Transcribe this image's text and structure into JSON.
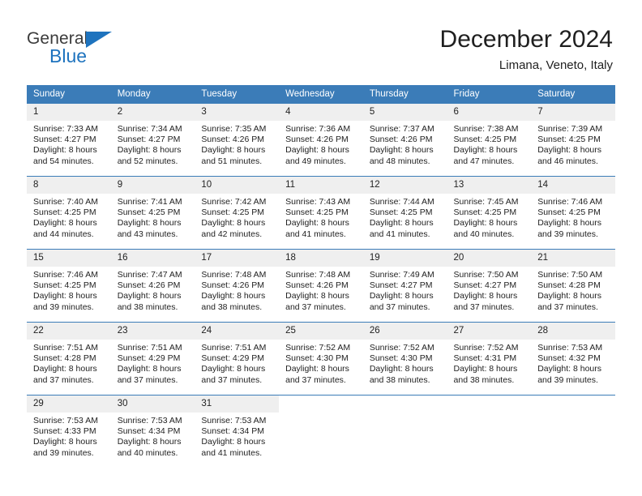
{
  "brand": {
    "name_top": "General",
    "name_bottom": "Blue",
    "accent_color": "#1e73be",
    "triangle_icon": "triangle-icon"
  },
  "header": {
    "title": "December 2024",
    "subtitle": "Limana, Veneto, Italy"
  },
  "theme": {
    "header_row_color": "#3b7cb8",
    "daynum_band_color": "#efefef",
    "text_color": "#222222",
    "page_background": "#ffffff"
  },
  "calendar": {
    "weekday_headers": [
      "Sunday",
      "Monday",
      "Tuesday",
      "Wednesday",
      "Thursday",
      "Friday",
      "Saturday"
    ],
    "weeks": [
      [
        {
          "day": "1",
          "sunrise": "Sunrise: 7:33 AM",
          "sunset": "Sunset: 4:27 PM",
          "daylight_line1": "Daylight: 8 hours",
          "daylight_line2": "and 54 minutes."
        },
        {
          "day": "2",
          "sunrise": "Sunrise: 7:34 AM",
          "sunset": "Sunset: 4:27 PM",
          "daylight_line1": "Daylight: 8 hours",
          "daylight_line2": "and 52 minutes."
        },
        {
          "day": "3",
          "sunrise": "Sunrise: 7:35 AM",
          "sunset": "Sunset: 4:26 PM",
          "daylight_line1": "Daylight: 8 hours",
          "daylight_line2": "and 51 minutes."
        },
        {
          "day": "4",
          "sunrise": "Sunrise: 7:36 AM",
          "sunset": "Sunset: 4:26 PM",
          "daylight_line1": "Daylight: 8 hours",
          "daylight_line2": "and 49 minutes."
        },
        {
          "day": "5",
          "sunrise": "Sunrise: 7:37 AM",
          "sunset": "Sunset: 4:26 PM",
          "daylight_line1": "Daylight: 8 hours",
          "daylight_line2": "and 48 minutes."
        },
        {
          "day": "6",
          "sunrise": "Sunrise: 7:38 AM",
          "sunset": "Sunset: 4:25 PM",
          "daylight_line1": "Daylight: 8 hours",
          "daylight_line2": "and 47 minutes."
        },
        {
          "day": "7",
          "sunrise": "Sunrise: 7:39 AM",
          "sunset": "Sunset: 4:25 PM",
          "daylight_line1": "Daylight: 8 hours",
          "daylight_line2": "and 46 minutes."
        }
      ],
      [
        {
          "day": "8",
          "sunrise": "Sunrise: 7:40 AM",
          "sunset": "Sunset: 4:25 PM",
          "daylight_line1": "Daylight: 8 hours",
          "daylight_line2": "and 44 minutes."
        },
        {
          "day": "9",
          "sunrise": "Sunrise: 7:41 AM",
          "sunset": "Sunset: 4:25 PM",
          "daylight_line1": "Daylight: 8 hours",
          "daylight_line2": "and 43 minutes."
        },
        {
          "day": "10",
          "sunrise": "Sunrise: 7:42 AM",
          "sunset": "Sunset: 4:25 PM",
          "daylight_line1": "Daylight: 8 hours",
          "daylight_line2": "and 42 minutes."
        },
        {
          "day": "11",
          "sunrise": "Sunrise: 7:43 AM",
          "sunset": "Sunset: 4:25 PM",
          "daylight_line1": "Daylight: 8 hours",
          "daylight_line2": "and 41 minutes."
        },
        {
          "day": "12",
          "sunrise": "Sunrise: 7:44 AM",
          "sunset": "Sunset: 4:25 PM",
          "daylight_line1": "Daylight: 8 hours",
          "daylight_line2": "and 41 minutes."
        },
        {
          "day": "13",
          "sunrise": "Sunrise: 7:45 AM",
          "sunset": "Sunset: 4:25 PM",
          "daylight_line1": "Daylight: 8 hours",
          "daylight_line2": "and 40 minutes."
        },
        {
          "day": "14",
          "sunrise": "Sunrise: 7:46 AM",
          "sunset": "Sunset: 4:25 PM",
          "daylight_line1": "Daylight: 8 hours",
          "daylight_line2": "and 39 minutes."
        }
      ],
      [
        {
          "day": "15",
          "sunrise": "Sunrise: 7:46 AM",
          "sunset": "Sunset: 4:25 PM",
          "daylight_line1": "Daylight: 8 hours",
          "daylight_line2": "and 39 minutes."
        },
        {
          "day": "16",
          "sunrise": "Sunrise: 7:47 AM",
          "sunset": "Sunset: 4:26 PM",
          "daylight_line1": "Daylight: 8 hours",
          "daylight_line2": "and 38 minutes."
        },
        {
          "day": "17",
          "sunrise": "Sunrise: 7:48 AM",
          "sunset": "Sunset: 4:26 PM",
          "daylight_line1": "Daylight: 8 hours",
          "daylight_line2": "and 38 minutes."
        },
        {
          "day": "18",
          "sunrise": "Sunrise: 7:48 AM",
          "sunset": "Sunset: 4:26 PM",
          "daylight_line1": "Daylight: 8 hours",
          "daylight_line2": "and 37 minutes."
        },
        {
          "day": "19",
          "sunrise": "Sunrise: 7:49 AM",
          "sunset": "Sunset: 4:27 PM",
          "daylight_line1": "Daylight: 8 hours",
          "daylight_line2": "and 37 minutes."
        },
        {
          "day": "20",
          "sunrise": "Sunrise: 7:50 AM",
          "sunset": "Sunset: 4:27 PM",
          "daylight_line1": "Daylight: 8 hours",
          "daylight_line2": "and 37 minutes."
        },
        {
          "day": "21",
          "sunrise": "Sunrise: 7:50 AM",
          "sunset": "Sunset: 4:28 PM",
          "daylight_line1": "Daylight: 8 hours",
          "daylight_line2": "and 37 minutes."
        }
      ],
      [
        {
          "day": "22",
          "sunrise": "Sunrise: 7:51 AM",
          "sunset": "Sunset: 4:28 PM",
          "daylight_line1": "Daylight: 8 hours",
          "daylight_line2": "and 37 minutes."
        },
        {
          "day": "23",
          "sunrise": "Sunrise: 7:51 AM",
          "sunset": "Sunset: 4:29 PM",
          "daylight_line1": "Daylight: 8 hours",
          "daylight_line2": "and 37 minutes."
        },
        {
          "day": "24",
          "sunrise": "Sunrise: 7:51 AM",
          "sunset": "Sunset: 4:29 PM",
          "daylight_line1": "Daylight: 8 hours",
          "daylight_line2": "and 37 minutes."
        },
        {
          "day": "25",
          "sunrise": "Sunrise: 7:52 AM",
          "sunset": "Sunset: 4:30 PM",
          "daylight_line1": "Daylight: 8 hours",
          "daylight_line2": "and 37 minutes."
        },
        {
          "day": "26",
          "sunrise": "Sunrise: 7:52 AM",
          "sunset": "Sunset: 4:30 PM",
          "daylight_line1": "Daylight: 8 hours",
          "daylight_line2": "and 38 minutes."
        },
        {
          "day": "27",
          "sunrise": "Sunrise: 7:52 AM",
          "sunset": "Sunset: 4:31 PM",
          "daylight_line1": "Daylight: 8 hours",
          "daylight_line2": "and 38 minutes."
        },
        {
          "day": "28",
          "sunrise": "Sunrise: 7:53 AM",
          "sunset": "Sunset: 4:32 PM",
          "daylight_line1": "Daylight: 8 hours",
          "daylight_line2": "and 39 minutes."
        }
      ],
      [
        {
          "day": "29",
          "sunrise": "Sunrise: 7:53 AM",
          "sunset": "Sunset: 4:33 PM",
          "daylight_line1": "Daylight: 8 hours",
          "daylight_line2": "and 39 minutes."
        },
        {
          "day": "30",
          "sunrise": "Sunrise: 7:53 AM",
          "sunset": "Sunset: 4:34 PM",
          "daylight_line1": "Daylight: 8 hours",
          "daylight_line2": "and 40 minutes."
        },
        {
          "day": "31",
          "sunrise": "Sunrise: 7:53 AM",
          "sunset": "Sunset: 4:34 PM",
          "daylight_line1": "Daylight: 8 hours",
          "daylight_line2": "and 41 minutes."
        },
        {
          "day": "",
          "sunrise": "",
          "sunset": "",
          "daylight_line1": "",
          "daylight_line2": ""
        },
        {
          "day": "",
          "sunrise": "",
          "sunset": "",
          "daylight_line1": "",
          "daylight_line2": ""
        },
        {
          "day": "",
          "sunrise": "",
          "sunset": "",
          "daylight_line1": "",
          "daylight_line2": ""
        },
        {
          "day": "",
          "sunrise": "",
          "sunset": "",
          "daylight_line1": "",
          "daylight_line2": ""
        }
      ]
    ]
  }
}
